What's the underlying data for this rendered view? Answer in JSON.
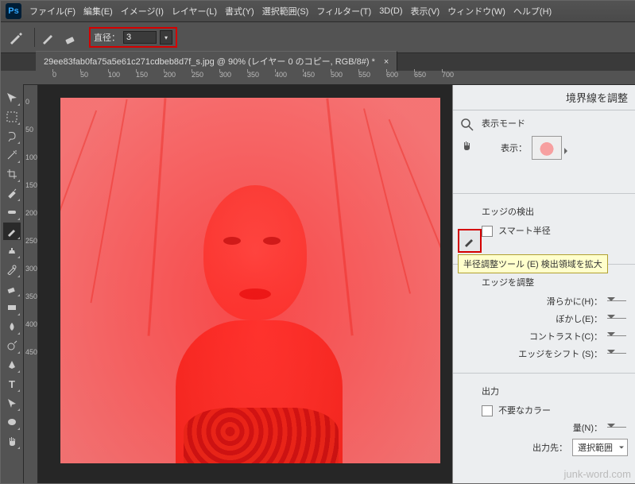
{
  "app": {
    "logo": "Ps"
  },
  "menu": [
    "ファイル(F)",
    "編集(E)",
    "イメージ(I)",
    "レイヤー(L)",
    "書式(Y)",
    "選択範囲(S)",
    "フィルター(T)",
    "3D(D)",
    "表示(V)",
    "ウィンドウ(W)",
    "ヘルプ(H)"
  ],
  "options": {
    "diameter_label": "直径：",
    "diameter_value": "3"
  },
  "document": {
    "tab_title": "29ee83fab0fa75a5e61c271cdbeb8d7f_s.jpg @ 90% (レイヤー 0 のコピー, RGB/8#) *",
    "close_glyph": "×"
  },
  "ruler": {
    "h": [
      "0",
      "50",
      "100",
      "150",
      "200",
      "250",
      "300",
      "350",
      "400",
      "450",
      "500",
      "550",
      "600",
      "650",
      "700"
    ],
    "v": [
      "0",
      "50",
      "100",
      "150",
      "200",
      "250",
      "300",
      "350",
      "400",
      "450"
    ]
  },
  "panel": {
    "title": "境界線を調整",
    "view_mode_label": "表示モード",
    "show_label": "表示：",
    "edge_detect_label": "エッジの検出",
    "smart_radius_label": "スマート半径",
    "tooltip": "半径調整ツール (E) 検出領域を拡大",
    "adjust_edge_label": "エッジを調整",
    "sliders": {
      "smooth": "滑らかに(H)：",
      "feather": "ぼかし(E)：",
      "contrast": "コントラスト(C)：",
      "shift": "エッジをシフト (S)："
    },
    "output_label": "出力",
    "decontaminate_label": "不要なカラー",
    "amount_label": "量(N)：",
    "output_to_label": "出力先：",
    "output_to_value": "選択範囲"
  },
  "watermark": "junk-word.com"
}
